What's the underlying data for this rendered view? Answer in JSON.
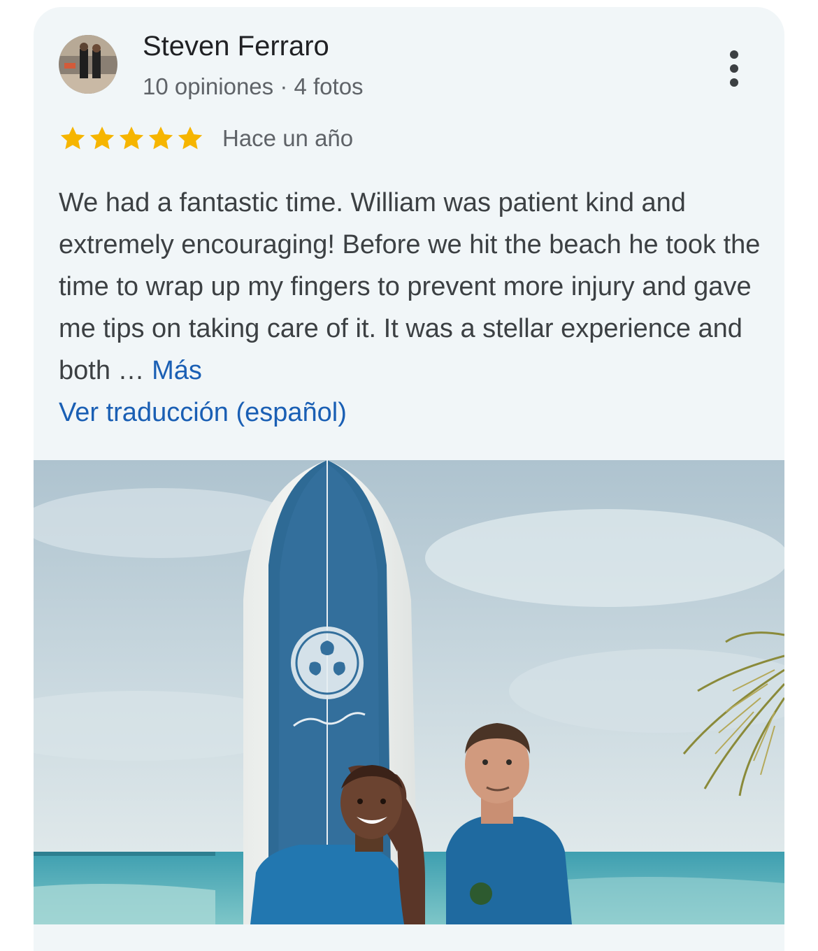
{
  "review": {
    "reviewer_name": "Steven Ferraro",
    "reviewer_meta": "10 opiniones · 4 fotos",
    "rating": 5,
    "rating_max": 5,
    "time_ago": "Hace un año",
    "text": "We had a fantastic time. William was patient kind and extremely encouraging! Before we hit the beach he took the time to wrap up my fingers to prevent more injury and gave me tips on taking care of it. It was a stellar experience and both … ",
    "more_label": "Más",
    "translate_label": "Ver traducción (español)",
    "star_color": "#f6b500",
    "link_color": "#1a5fb4"
  }
}
